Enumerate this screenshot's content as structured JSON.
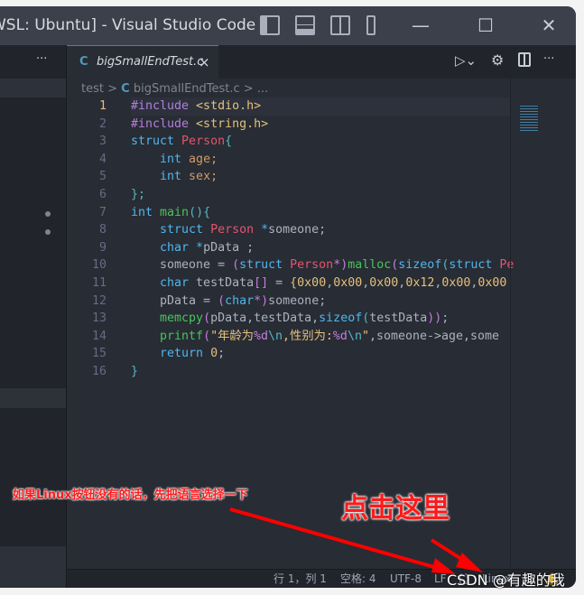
{
  "window": {
    "title": "WSL: Ubuntu] - Visual Studio Code"
  },
  "sidebar": {
    "more": "···"
  },
  "tab": {
    "icon": "C",
    "label": "bigSmallEndTest.c",
    "close": "×"
  },
  "toolbar": {
    "more": "···"
  },
  "breadcrumb": {
    "folder": "test",
    "sep": ">",
    "icon": "C",
    "file": "bigSmallEndTest.c",
    "tail": "> ..."
  },
  "code": [
    [
      [
        "#include",
        "p"
      ],
      [
        " <stdio.h>",
        "s"
      ]
    ],
    [
      [
        "#include",
        "p"
      ],
      [
        " <string.h>",
        "s"
      ]
    ],
    [
      [
        "struct",
        "k"
      ],
      [
        " Person",
        "ty"
      ],
      [
        "{",
        "o"
      ]
    ],
    [
      [
        "    int",
        "k"
      ],
      [
        " age;",
        "v"
      ]
    ],
    [
      [
        "    int",
        "k"
      ],
      [
        " sex;",
        "v"
      ]
    ],
    [
      [
        "};",
        "o"
      ]
    ],
    [
      [
        "int",
        "k"
      ],
      [
        " main",
        "f"
      ],
      [
        "(){",
        "o"
      ]
    ],
    [
      [
        "    struct",
        "k"
      ],
      [
        " Person",
        "ty"
      ],
      [
        " *",
        "k"
      ],
      [
        "someone;",
        "d"
      ]
    ],
    [
      [
        "    char",
        "k"
      ],
      [
        " *",
        "k"
      ],
      [
        "pData ;",
        "d"
      ]
    ],
    [
      [
        "    someone = ",
        "d"
      ],
      [
        "(",
        "b"
      ],
      [
        "struct",
        "k"
      ],
      [
        " Person",
        "ty"
      ],
      [
        "*)",
        "b"
      ],
      [
        "malloc",
        "f"
      ],
      [
        "(",
        "b"
      ],
      [
        "sizeof",
        "k"
      ],
      [
        "(",
        "o"
      ],
      [
        "struct",
        "k"
      ],
      [
        " Pe",
        "ty"
      ]
    ],
    [
      [
        "    char",
        "k"
      ],
      [
        " testData",
        "d"
      ],
      [
        "[]",
        "b"
      ],
      [
        " = ",
        "d"
      ],
      [
        "{",
        "s"
      ],
      [
        "0x00",
        "n"
      ],
      [
        ",",
        "d"
      ],
      [
        "0x00",
        "n"
      ],
      [
        ",",
        "d"
      ],
      [
        "0x00",
        "n"
      ],
      [
        ",",
        "d"
      ],
      [
        "0x12",
        "n"
      ],
      [
        ",",
        "d"
      ],
      [
        "0x00",
        "n"
      ],
      [
        ",",
        "d"
      ],
      [
        "0x00",
        "n"
      ]
    ],
    [
      [
        "    pData = ",
        "d"
      ],
      [
        "(",
        "b"
      ],
      [
        "char",
        "k"
      ],
      [
        "*",
        "b"
      ],
      [
        ")",
        "b"
      ],
      [
        "someone;",
        "d"
      ]
    ],
    [
      [
        "    memcpy",
        "f"
      ],
      [
        "(",
        "b"
      ],
      [
        "pData,testData,",
        "d"
      ],
      [
        "sizeof",
        "k"
      ],
      [
        "(",
        "o"
      ],
      [
        "testData",
        "d"
      ],
      [
        "))",
        "b"
      ],
      [
        ";",
        "d"
      ]
    ],
    [
      [
        "    printf",
        "f"
      ],
      [
        "(",
        "b"
      ],
      [
        "\"年龄为",
        "s"
      ],
      [
        "%d",
        "b"
      ],
      [
        "\\n",
        "o"
      ],
      [
        ",性别为:",
        "s"
      ],
      [
        "%d",
        "b"
      ],
      [
        "\\n",
        "o"
      ],
      [
        "\"",
        "s"
      ],
      [
        ",someone->age,some",
        "d"
      ]
    ],
    [
      [
        "    return",
        "k"
      ],
      [
        " 0",
        "n"
      ],
      [
        ";",
        "d"
      ]
    ],
    [
      [
        "}",
        "o"
      ]
    ]
  ],
  "status": {
    "position": "行 1，列 1",
    "indent": "空格: 4",
    "encoding": "UTF-8",
    "eol": "LF",
    "lang_icon": "{}",
    "platform": "Linux"
  },
  "annotations": {
    "hint": "如果Linux按钮没有的话，先把语言选择一下",
    "click": "点击这里",
    "watermark": "CSDN @有趣的我"
  },
  "colors": {
    "accent": "#4d78cc",
    "arrow": "#ff0000"
  }
}
